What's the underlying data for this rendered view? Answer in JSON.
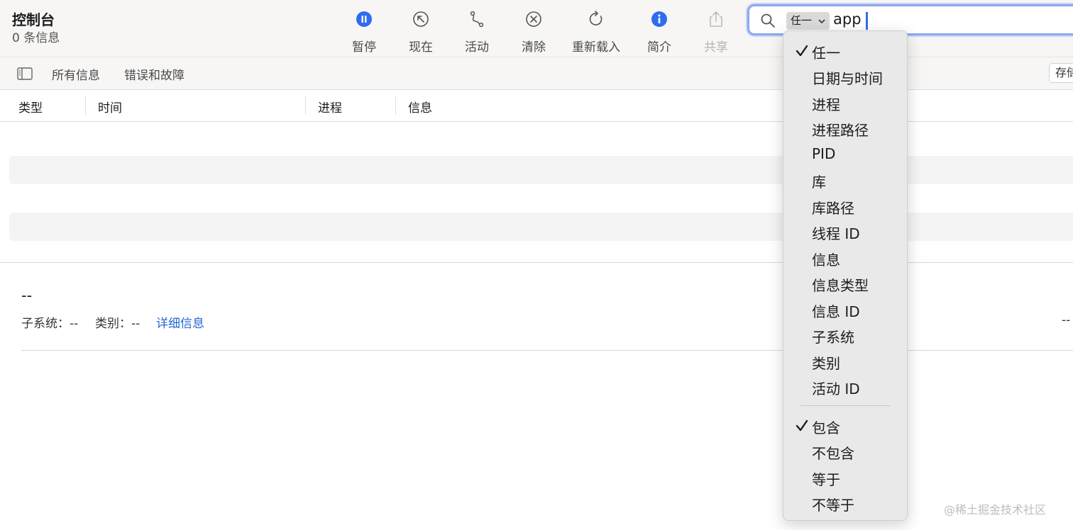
{
  "window": {
    "title": "控制台",
    "subtitle": "0 条信息"
  },
  "toolbar": {
    "pause": "暂停",
    "now": "现在",
    "activity": "活动",
    "clear": "清除",
    "reload": "重新载入",
    "info": "简介",
    "share": "共享"
  },
  "search": {
    "token": "任一",
    "query": "app"
  },
  "filterbar": {
    "all": "所有信息",
    "errors": "错误和故障",
    "save": "存储"
  },
  "table": {
    "columns": [
      "类型",
      "时间",
      "进程",
      "信息"
    ]
  },
  "detail": {
    "title": "--",
    "subsystem": "子系统：--",
    "category": "类别：--",
    "more_link": "详细信息",
    "right_value": "--"
  },
  "menu": {
    "fields": [
      "任一",
      "日期与时间",
      "进程",
      "进程路径",
      "PID",
      "库",
      "库路径",
      "线程 ID",
      "信息",
      "信息类型",
      "信息 ID",
      "子系统",
      "类别",
      "活动 ID"
    ],
    "operators": [
      "包含",
      "不包含",
      "等于",
      "不等于"
    ],
    "selected_field": "任一",
    "selected_operator": "包含"
  },
  "colors": {
    "accent": "#2f6cf0",
    "link": "#2466d6",
    "search_focus": "#8ea8ef"
  },
  "watermark": "@稀土掘金技术社区"
}
